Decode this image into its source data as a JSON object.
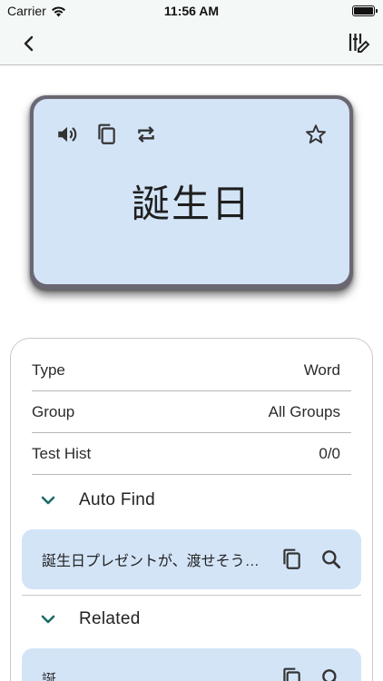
{
  "status_bar": {
    "carrier": "Carrier",
    "time": "11:56 AM"
  },
  "nav": {
    "back_icon": "chevron-left-icon",
    "filter_icon": "tune-icon"
  },
  "card": {
    "word": "誕生日",
    "icons": [
      "volume-icon",
      "copy-icon",
      "repeat-icon",
      "star-outline-icon"
    ]
  },
  "details": {
    "rows": [
      {
        "label": "Type",
        "value": "Word"
      },
      {
        "label": "Group",
        "value": "All Groups"
      },
      {
        "label": "Test Hist",
        "value": "0/0"
      }
    ],
    "auto_find": {
      "title": "Auto Find",
      "text": "誕生日プレゼントが、渡せそうになかったので、代わりに"
    },
    "related": {
      "title": "Related",
      "text": "誕"
    }
  },
  "colors": {
    "card_bg": "#d3e4f7",
    "card_frame": "#6a6773",
    "accent": "#1b6b66"
  }
}
